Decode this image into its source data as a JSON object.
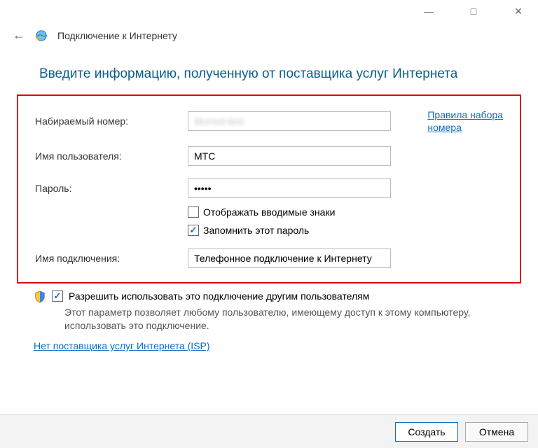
{
  "titlebar": {
    "minimize": "—",
    "maximize": "□",
    "close": "✕"
  },
  "header": {
    "window_title": "Подключение к Интернету"
  },
  "main": {
    "heading": "Введите информацию, полученную от поставщика услуг Интернета",
    "labels": {
      "dial_number": "Набираемый номер:",
      "username": "Имя пользователя:",
      "password": "Пароль:",
      "connection_name": "Имя подключения:"
    },
    "values": {
      "dial_number": "blurred-text",
      "username": "МТС",
      "password": "•••••",
      "connection_name": "Телефонное подключение к Интернету"
    },
    "dialing_rules_link_l1": "Правила набора",
    "dialing_rules_link_l2": "номера",
    "show_chars_label": "Отображать вводимые знаки",
    "show_chars_checked": false,
    "remember_pw_label": "Запомнить этот пароль",
    "remember_pw_checked": true
  },
  "sharing": {
    "allow_label": "Разрешить использовать это подключение другим пользователям",
    "allow_checked": true,
    "description": "Этот параметр позволяет любому пользователю, имеющему доступ к этому компьютеру, использовать это подключение."
  },
  "isp_link": "Нет поставщика услуг Интернета (ISP)",
  "footer": {
    "create": "Создать",
    "cancel": "Отмена"
  }
}
